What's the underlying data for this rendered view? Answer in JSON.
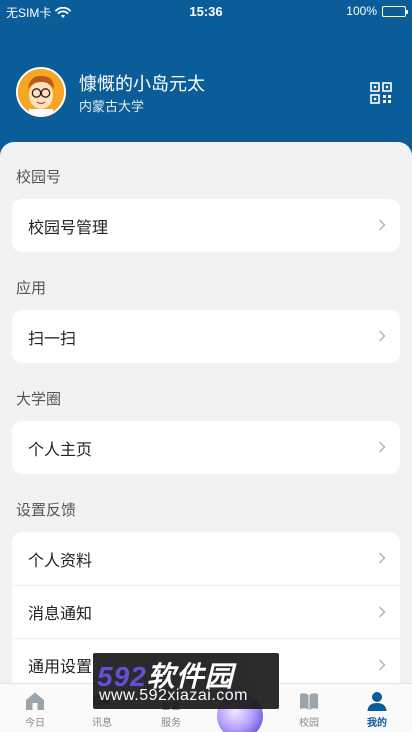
{
  "status": {
    "carrier": "无SIM卡",
    "time": "15:36",
    "battery": "100%"
  },
  "profile": {
    "name": "慷慨的小岛元太",
    "school": "内蒙古大学"
  },
  "sections": [
    {
      "title": "校园号",
      "items": [
        "校园号管理"
      ]
    },
    {
      "title": "应用",
      "items": [
        "扫一扫"
      ]
    },
    {
      "title": "大学圈",
      "items": [
        "个人主页"
      ]
    },
    {
      "title": "设置反馈",
      "items": [
        "个人资料",
        "消息通知",
        "通用设置"
      ]
    }
  ],
  "tabs": [
    "今日",
    "讯息",
    "服务",
    "校园",
    "我的"
  ],
  "active_tab": "我的",
  "watermark": {
    "logo_number": "592",
    "logo_text": "软件园",
    "url": "www.592xiazai.com"
  },
  "colors": {
    "primary": "#0b5d9a",
    "background": "#f2f2f4"
  }
}
